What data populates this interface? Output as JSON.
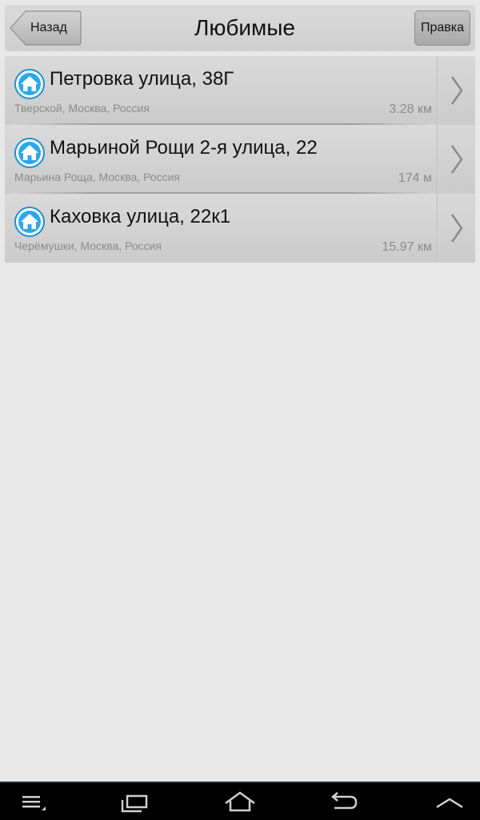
{
  "header": {
    "back_label": "Назад",
    "title": "Любимые",
    "edit_label": "Правка"
  },
  "favorites": [
    {
      "icon": "home-icon",
      "name": "Петровка улица, 38Г",
      "address": "Тверской, Москва, Россия",
      "distance": "3.28 км"
    },
    {
      "icon": "home-icon",
      "name": "Марьиной Рощи 2-я улица, 22",
      "address": "Марьина Роща, Москва, Россия",
      "distance": "174 м"
    },
    {
      "icon": "home-icon",
      "name": "Каховка улица, 22к1",
      "address": "Черёмушки, Москва, Россия",
      "distance": "15.97 км"
    }
  ],
  "navbar": {
    "buttons": [
      "menu-icon",
      "recent-apps-icon",
      "home-icon",
      "back-icon",
      "chevron-up-icon"
    ]
  },
  "colors": {
    "background": "#e8e8e8",
    "row": "#d2d2d2",
    "icon_blue": "#1e9be0",
    "navbar": "#000000"
  }
}
